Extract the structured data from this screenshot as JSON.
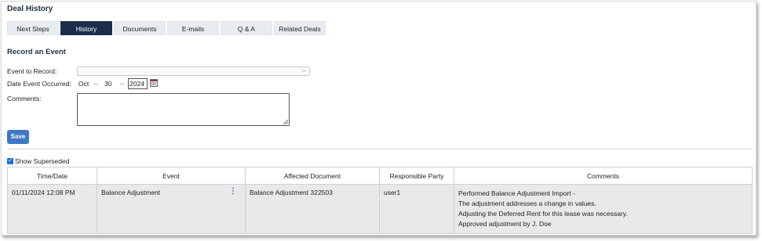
{
  "page_title": "Deal History",
  "tabs": [
    {
      "label": "Next Steps"
    },
    {
      "label": "History",
      "active": true
    },
    {
      "label": "Documents"
    },
    {
      "label": "E-mails"
    },
    {
      "label": "Q & A"
    },
    {
      "label": "Related Deals"
    }
  ],
  "record": {
    "title": "Record an Event",
    "event_label": "Event to Record:",
    "event_value": "",
    "date_label": "Date Event Occurred:",
    "month": "Oct",
    "day": "30",
    "year": "2024",
    "comments_label": "Comments:",
    "comments_value": "",
    "save_label": "Save"
  },
  "show_superseded": {
    "label": "Show Superseded",
    "checked": true
  },
  "table": {
    "headers": [
      "Time/Date",
      "Event",
      "Affected Document",
      "Responsible Party",
      "Comments"
    ],
    "rows": [
      {
        "time": "01/11/2024 12:08 PM",
        "event": "Balance Adjustment",
        "document": "Balance Adjustment 322503",
        "party": "user1",
        "comments": [
          "Performed Balance Adjustment Import -",
          "The adjustment addresses a change in values.",
          "Adjusting the Deferred Rent for this lease was necessary.",
          "Approved adjustment by J. Doe"
        ]
      }
    ]
  },
  "colors": {
    "active_tab": "#1b2d4a",
    "tab_bg": "#e8ecf1",
    "save_button": "#3c78c6",
    "row_bg": "#e9e9e9",
    "kebab": "#2a6cc6"
  },
  "icons": {
    "calendar": "calendar-icon",
    "dropdown": "chevron-down-icon",
    "row_menu": "kebab-menu-icon"
  }
}
